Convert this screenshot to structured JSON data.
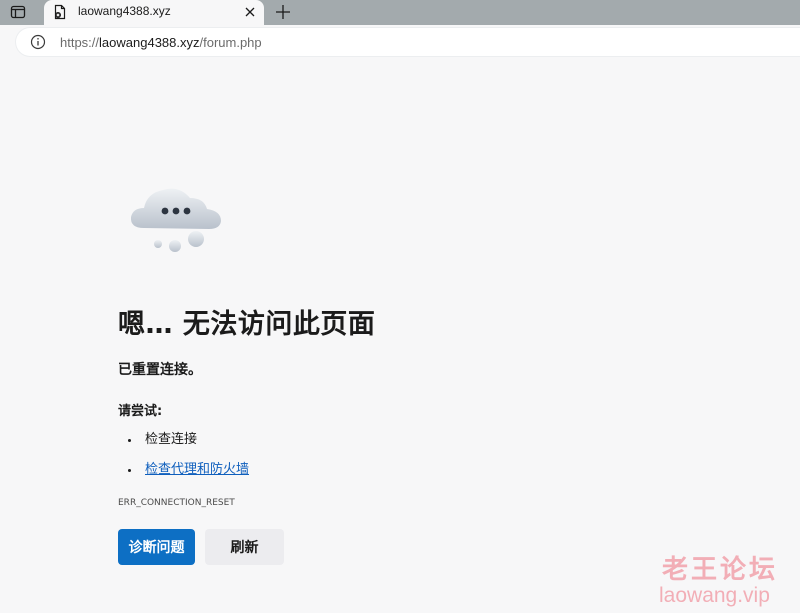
{
  "browser": {
    "tab": {
      "title": "laowang4388.xyz"
    },
    "address": {
      "scheme": "https://",
      "host": "laowang4388.xyz",
      "path": "/forum.php"
    }
  },
  "error": {
    "heading": "嗯… 无法访问此页面",
    "subtitle": "已重置连接。",
    "try_label": "请尝试:",
    "suggestions": [
      {
        "text": "检查连接",
        "link": false
      },
      {
        "text": "检查代理和防火墙",
        "link": true
      }
    ],
    "code": "ERR_CONNECTION_RESET",
    "buttons": {
      "diagnose": "诊断问题",
      "refresh": "刷新"
    }
  },
  "watermark": {
    "cn": "老王论坛",
    "en": "laowang.vip"
  },
  "colors": {
    "tabstrip": "#a3aaad",
    "page_bg": "#f7f7f8",
    "primary_button": "#0d6fc4",
    "link": "#0f5fbd"
  },
  "icons": {
    "sidebar": "sidebar-toggle-icon",
    "favicon": "page-error-icon",
    "close": "close-icon",
    "new_tab": "plus-icon",
    "info": "info-icon",
    "illustration": "cloud-icon"
  }
}
